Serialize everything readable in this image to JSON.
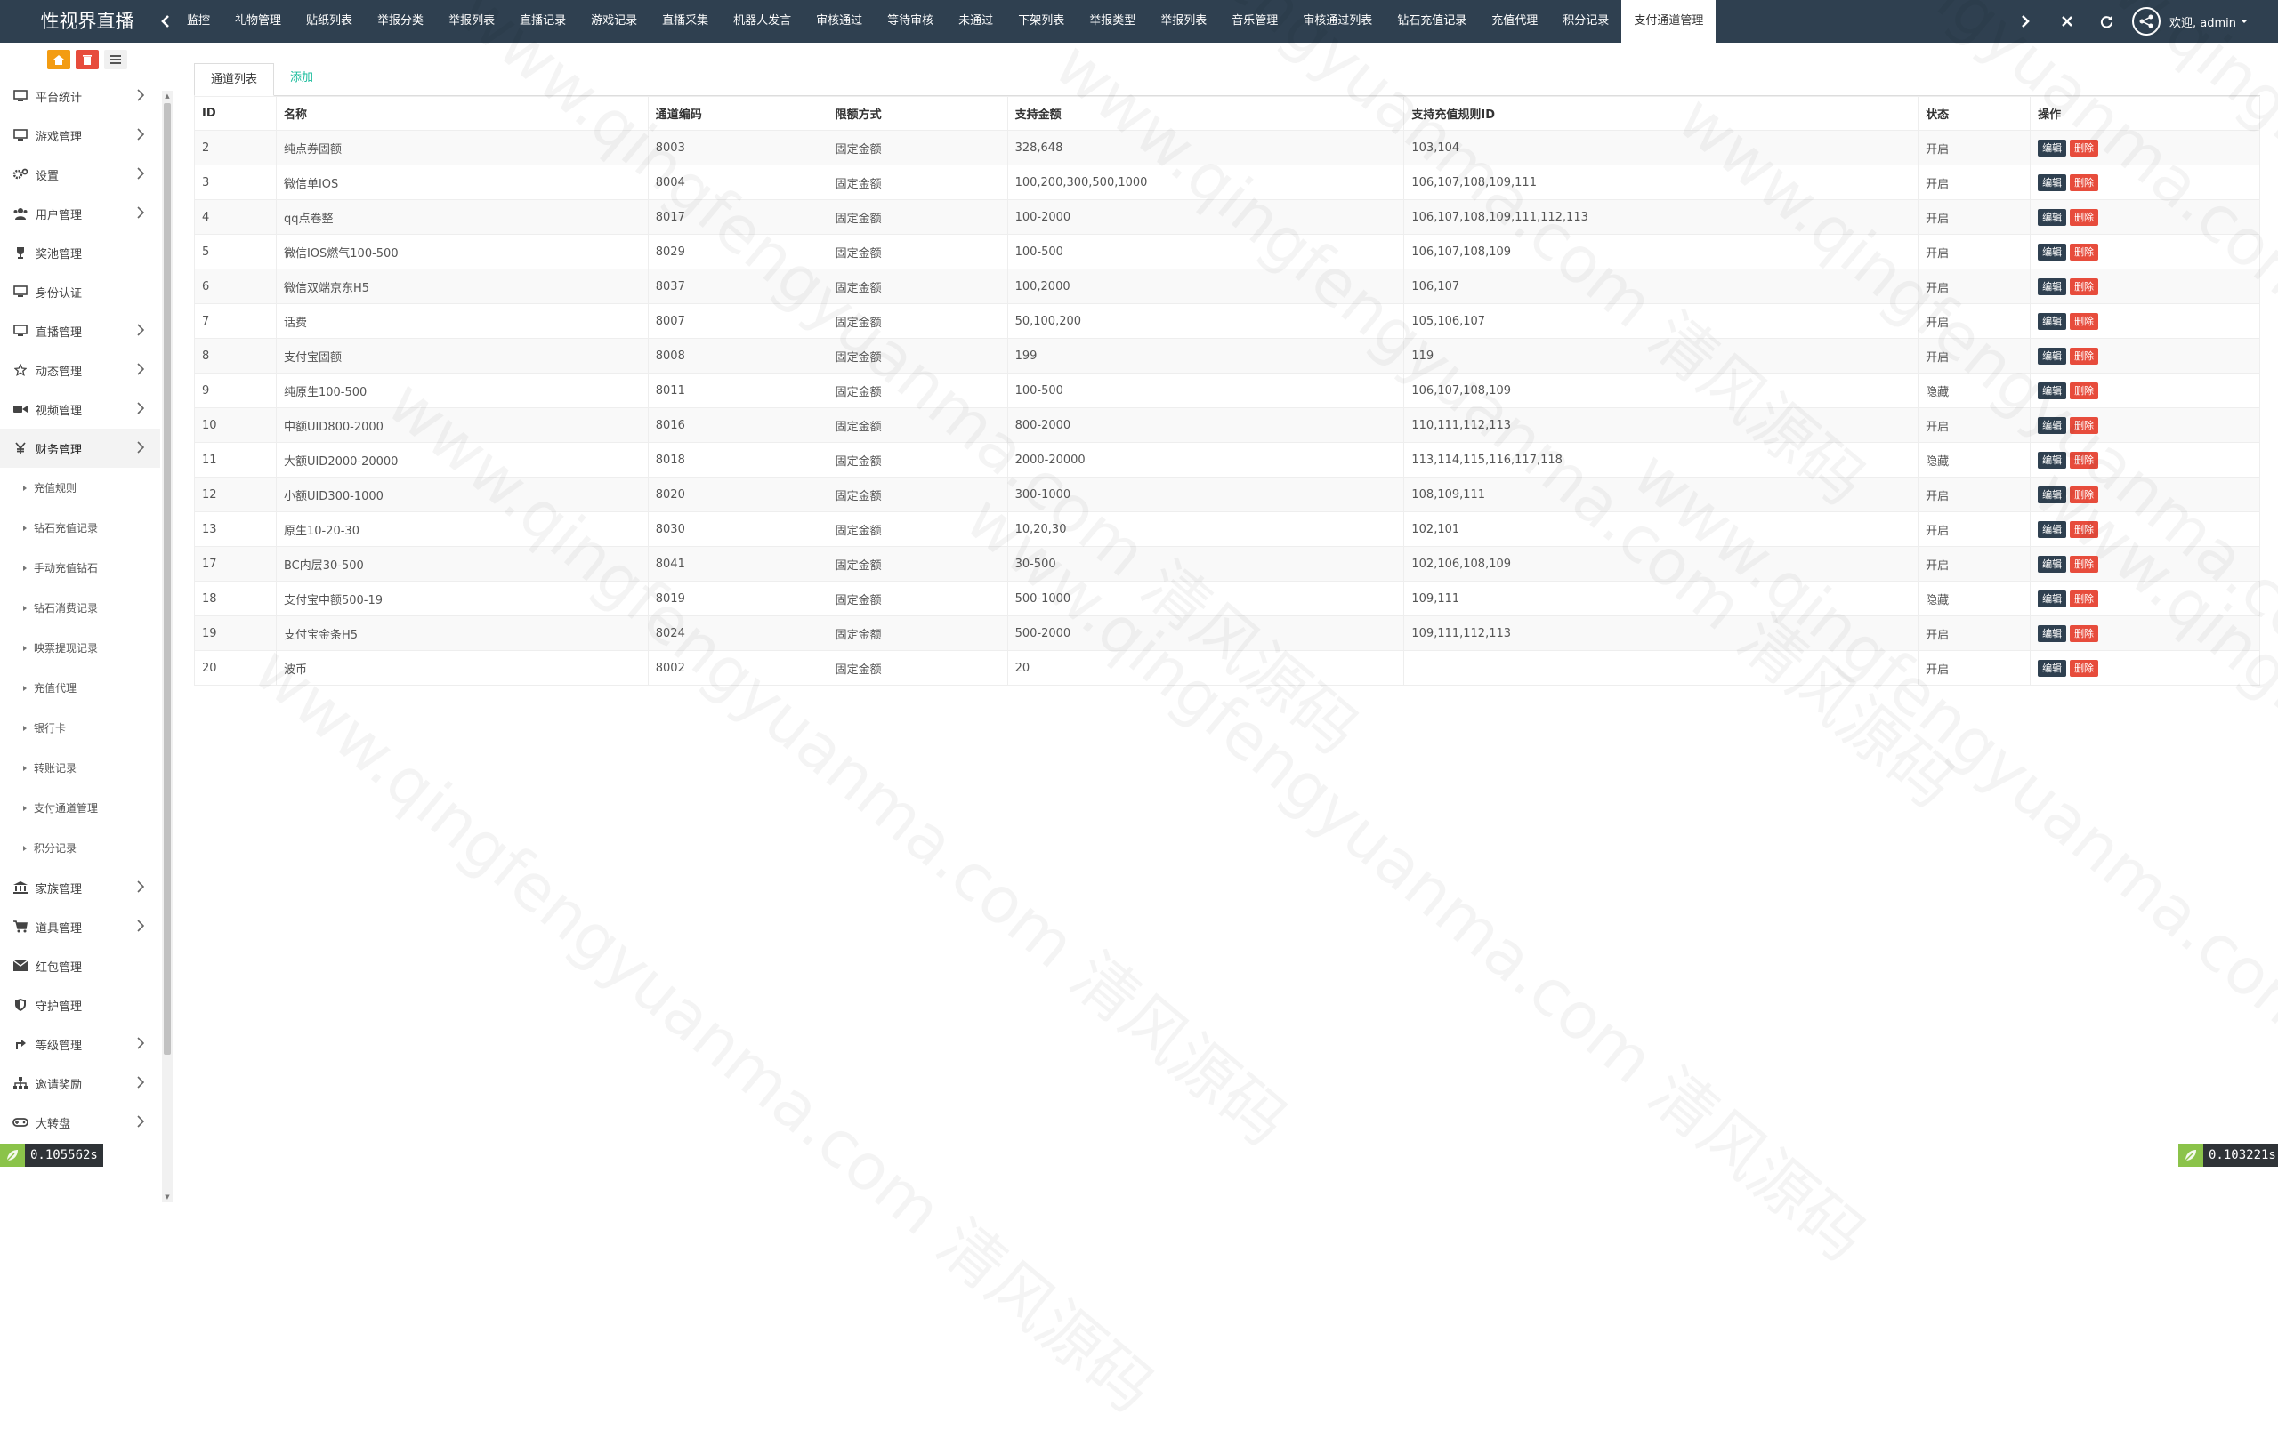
{
  "brand": "性视界直播",
  "tabs": [
    "监控",
    "礼物管理",
    "贴纸列表",
    "举报分类",
    "举报列表",
    "直播记录",
    "游戏记录",
    "直播采集",
    "机器人发言",
    "审核通过",
    "等待审核",
    "未通过",
    "下架列表",
    "举报类型",
    "举报列表",
    "音乐管理",
    "审核通过列表",
    "钻石充值记录",
    "充值代理",
    "积分记录",
    "支付通道管理"
  ],
  "user": {
    "welcome": "欢迎, admin"
  },
  "sidebar": {
    "menu": [
      {
        "label": "平台统计",
        "icon": "monitor-icon",
        "arrow": true
      },
      {
        "label": "游戏管理",
        "icon": "monitor-icon",
        "arrow": true
      },
      {
        "label": "设置",
        "icon": "gears-icon",
        "arrow": true
      },
      {
        "label": "用户管理",
        "icon": "users-icon",
        "arrow": true
      },
      {
        "label": "奖池管理",
        "icon": "trophy-icon",
        "arrow": false
      },
      {
        "label": "身份认证",
        "icon": "monitor-icon",
        "arrow": false
      },
      {
        "label": "直播管理",
        "icon": "monitor-icon",
        "arrow": true
      },
      {
        "label": "动态管理",
        "icon": "star-icon",
        "arrow": true
      },
      {
        "label": "视频管理",
        "icon": "video-icon",
        "arrow": true
      },
      {
        "label": "财务管理",
        "icon": "yen-icon",
        "arrow": true,
        "open": true
      }
    ],
    "finance_sub": [
      "充值规则",
      "钻石充值记录",
      "手动充值钻石",
      "钻石消费记录",
      "映票提现记录",
      "充值代理",
      "银行卡",
      "转账记录",
      "支付通道管理",
      "积分记录"
    ],
    "menu_after": [
      {
        "label": "家族管理",
        "icon": "bank-icon",
        "arrow": true
      },
      {
        "label": "道具管理",
        "icon": "cart-icon",
        "arrow": true
      },
      {
        "label": "红包管理",
        "icon": "envelope-icon",
        "arrow": false
      },
      {
        "label": "守护管理",
        "icon": "shield-icon",
        "arrow": false
      },
      {
        "label": "等级管理",
        "icon": "level-icon",
        "arrow": true
      },
      {
        "label": "邀请奖励",
        "icon": "sitemap-icon",
        "arrow": true
      },
      {
        "label": "大转盘",
        "icon": "gamepad-icon",
        "arrow": true
      }
    ]
  },
  "content_tabs": {
    "list": "通道列表",
    "add": "添加"
  },
  "table": {
    "headers": [
      "ID",
      "名称",
      "通道编码",
      "限额方式",
      "支持金额",
      "支持充值规则ID",
      "状态",
      "操作"
    ],
    "rows": [
      [
        "2",
        "纯点券固额",
        "8003",
        "固定金额",
        "328,648",
        "103,104",
        "开启"
      ],
      [
        "3",
        "微信单IOS",
        "8004",
        "固定金额",
        "100,200,300,500,1000",
        "106,107,108,109,111",
        "开启"
      ],
      [
        "4",
        "qq点卷整",
        "8017",
        "固定金额",
        "100-2000",
        "106,107,108,109,111,112,113",
        "开启"
      ],
      [
        "5",
        "微信IOS燃气100-500",
        "8029",
        "固定金额",
        "100-500",
        "106,107,108,109",
        "开启"
      ],
      [
        "6",
        "微信双端京东H5",
        "8037",
        "固定金额",
        "100,2000",
        "106,107",
        "开启"
      ],
      [
        "7",
        "话费",
        "8007",
        "固定金额",
        "50,100,200",
        "105,106,107",
        "开启"
      ],
      [
        "8",
        "支付宝固额",
        "8008",
        "固定金额",
        "199",
        "119",
        "开启"
      ],
      [
        "9",
        "纯原生100-500",
        "8011",
        "固定金额",
        "100-500",
        "106,107,108,109",
        "隐藏"
      ],
      [
        "10",
        "中额UID800-2000",
        "8016",
        "固定金额",
        "800-2000",
        "110,111,112,113",
        "开启"
      ],
      [
        "11",
        "大额UID2000-20000",
        "8018",
        "固定金额",
        "2000-20000",
        "113,114,115,116,117,118",
        "隐藏"
      ],
      [
        "12",
        "小额UID300-1000",
        "8020",
        "固定金额",
        "300-1000",
        "108,109,111",
        "开启"
      ],
      [
        "13",
        "原生10-20-30",
        "8030",
        "固定金额",
        "10,20,30",
        "102,101",
        "开启"
      ],
      [
        "17",
        "BC内层30-500",
        "8041",
        "固定金额",
        "30-500",
        "102,106,108,109",
        "开启"
      ],
      [
        "18",
        "支付宝中额500-19",
        "8019",
        "固定金额",
        "500-1000",
        "109,111",
        "隐藏"
      ],
      [
        "19",
        "支付宝金条H5",
        "8024",
        "固定金额",
        "500-2000",
        "109,111,112,113",
        "开启"
      ],
      [
        "20",
        "波币",
        "8002",
        "固定金额",
        "20",
        "",
        "开启"
      ]
    ],
    "edit_label": "编辑",
    "delete_label": "删除"
  },
  "watermark": "www.qingfengyuanma.com 清风源码",
  "timing_left": "0.105562s",
  "timing_right": "0.103221s",
  "colors": {
    "topbar": "#2f4050",
    "edit": "#2f4050",
    "delete": "#e74c3c",
    "link": "#1abc9c"
  }
}
